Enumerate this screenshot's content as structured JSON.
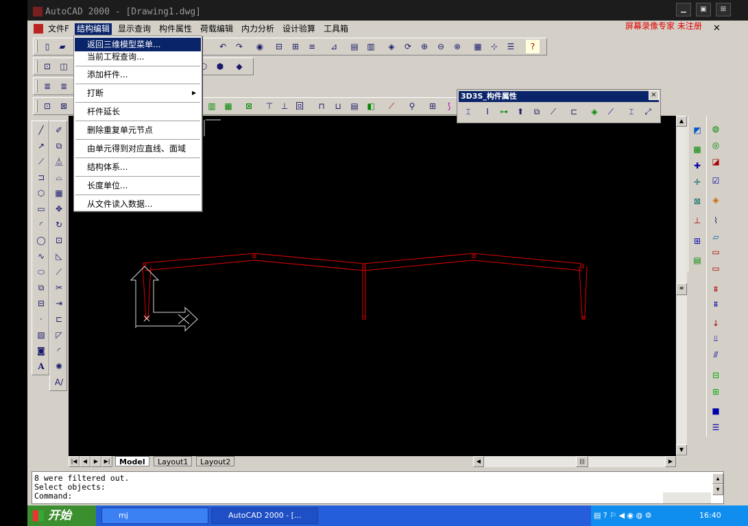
{
  "window": {
    "title": "AutoCAD 2000 - [Drawing1.dwg]",
    "registration_note": "屏幕录像专家 未注册"
  },
  "menubar": {
    "items": [
      "文件F",
      "结构编辑",
      "显示查询",
      "构件属性",
      "荷载编辑",
      "内力分析",
      "设计验算",
      "工具箱"
    ],
    "active_index": 1
  },
  "dropdown": {
    "items": [
      {
        "label": "返回三维模型菜单..."
      },
      {
        "label": "当前工程查询..."
      },
      {
        "label": "添加杆件..."
      },
      {
        "label": "打断"
      },
      {
        "label": "杆件延长"
      },
      {
        "label": "删除重复单元节点"
      },
      {
        "label": "由单元得到对应直线、面域"
      },
      {
        "label": "结构体系..."
      },
      {
        "label": "长度单位..."
      },
      {
        "label": "从文件读入数据..."
      }
    ],
    "submenu_arrow": "▶"
  },
  "panel": {
    "title": "3D3S_构件属性",
    "close": "×"
  },
  "layout_tabs": [
    "Model",
    "Layout1",
    "Layout2"
  ],
  "command_lines": [
    "8 were filtered out.",
    "Select objects:",
    "Command:"
  ],
  "taskbar": {
    "start_label": "开始",
    "tasks": [
      {
        "label": "mj"
      },
      {
        "label": "AutoCAD 2000 - [..."
      }
    ],
    "clock": "16:40"
  },
  "colors": {
    "accent": "#0a246a",
    "frame_line": "#e00000"
  },
  "icons": {
    "toolbar1": [
      "new-icon",
      "open-icon",
      "undo-icon",
      "redo-icon"
    ],
    "ucs": "ucs-icon"
  }
}
